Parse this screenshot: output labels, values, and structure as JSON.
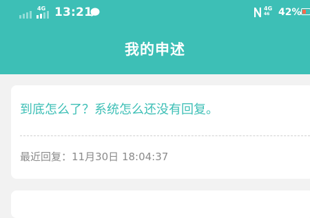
{
  "status_bar": {
    "network_left": "4G",
    "time": "13:21",
    "network_right": "4G",
    "network_right_sub": "46",
    "battery": "42%",
    "icons": [
      "signal-icon",
      "chat-icon",
      "nfc-icon",
      "battery-icon"
    ]
  },
  "header": {
    "title": "我的申述"
  },
  "appeals": [
    {
      "question": "到底怎么了？系统怎么还没有回复。",
      "reply_label": "最近回复：11月30日 18:04:37"
    }
  ],
  "colors": {
    "accent": "#3dbfb6",
    "background": "#f2f2f2",
    "card": "#ffffff",
    "meta_text": "#8a8a8a"
  }
}
